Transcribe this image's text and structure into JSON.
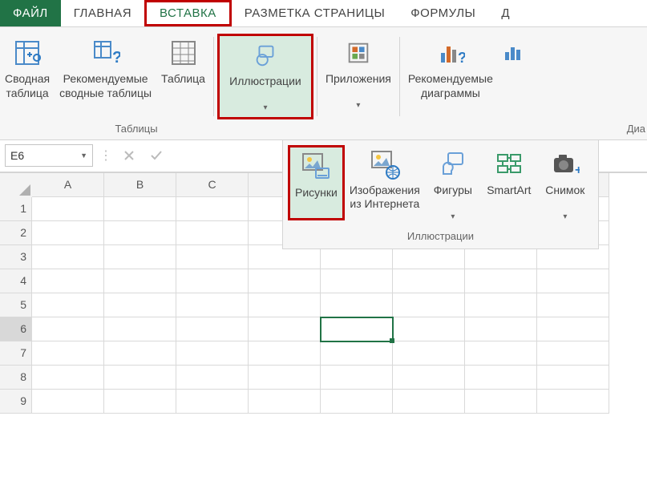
{
  "tabs": {
    "file": "ФАЙЛ",
    "home": "ГЛАВНАЯ",
    "insert": "ВСТАВКА",
    "pagelayout": "РАЗМЕТКА СТРАНИЦЫ",
    "formulas": "ФОРМУЛЫ",
    "data_partial": "Д"
  },
  "ribbon": {
    "pivot": "Сводная\nтаблица",
    "recpivot": "Рекомендуемые\nсводные таблицы",
    "table": "Таблица",
    "illustrations": "Иллюстрации",
    "apps": "Приложения",
    "reccharts": "Рекомендуемые\nдиаграммы",
    "group_tables": "Таблицы",
    "group_charts_partial": "Диа"
  },
  "gallery": {
    "pictures": "Рисунки",
    "onlinepics": "Изображения\nиз Интернета",
    "shapes": "Фигуры",
    "smartart": "SmartArt",
    "screenshot": "Снимок",
    "group_label": "Иллюстрации"
  },
  "fx": {
    "namebox": "E6"
  },
  "sheet": {
    "cols": [
      "A",
      "B",
      "C",
      "",
      "",
      "",
      "",
      ""
    ],
    "rows": [
      "1",
      "2",
      "3",
      "4",
      "5",
      "6",
      "7",
      "8",
      "9"
    ],
    "active_row": "6",
    "active_col_index": 4
  }
}
